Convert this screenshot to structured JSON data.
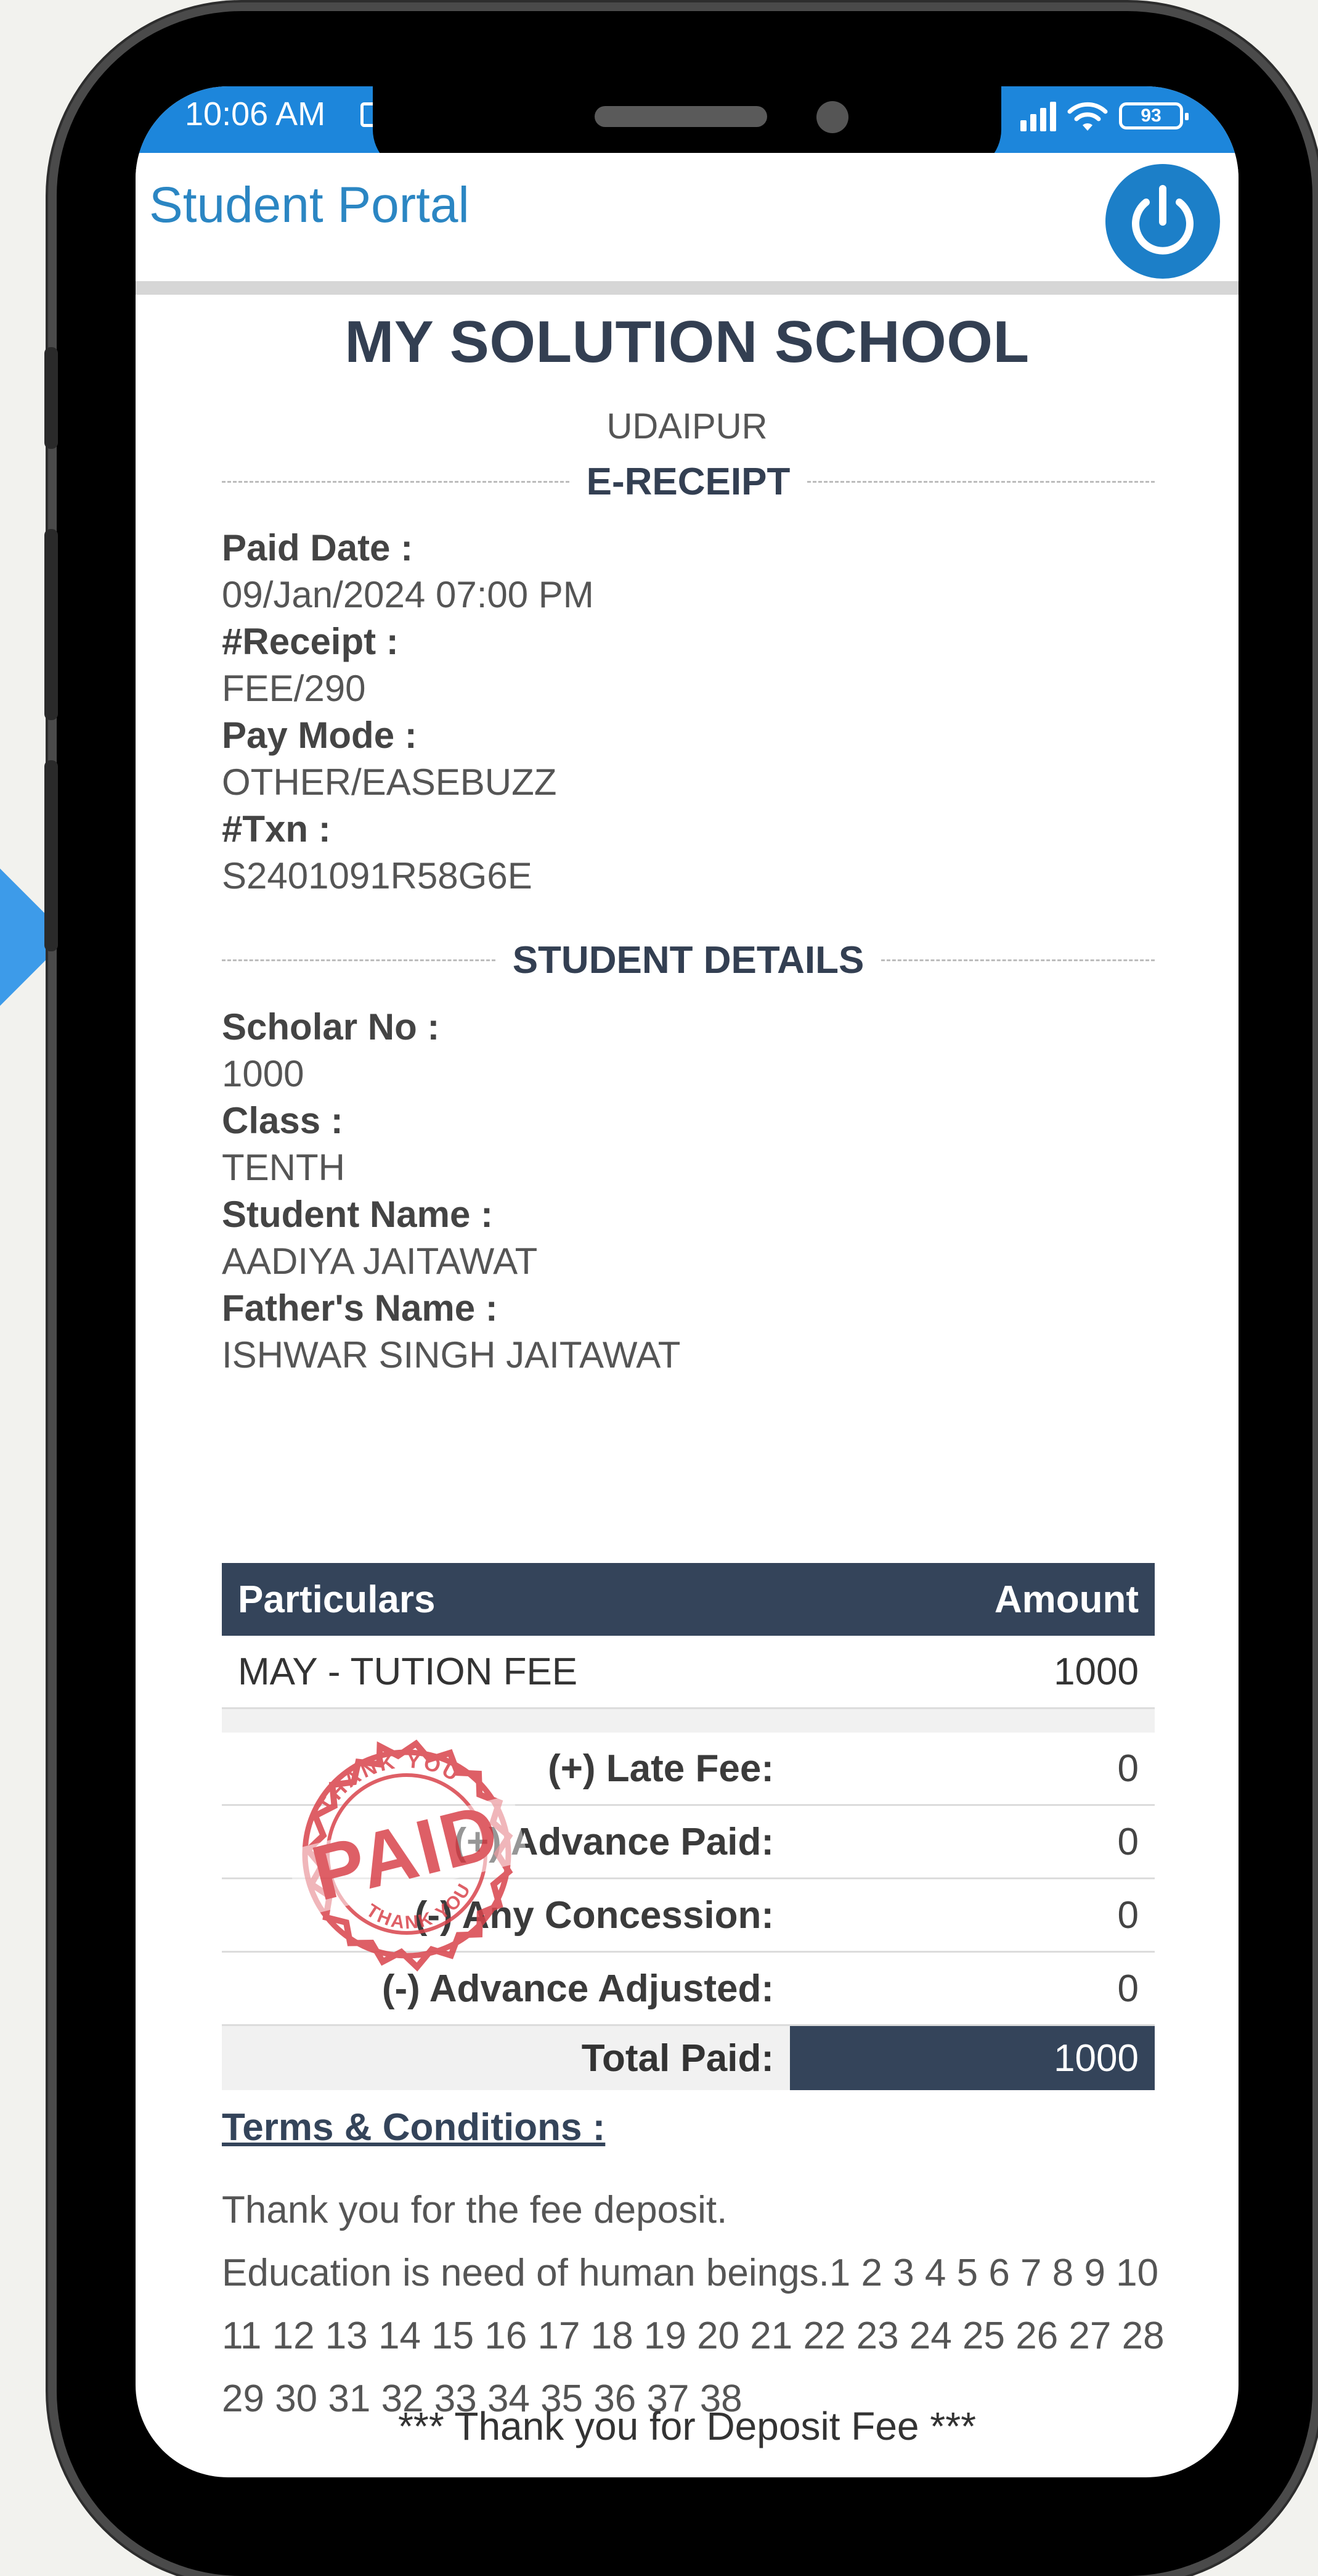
{
  "status_bar": {
    "time": "10:06 AM",
    "battery": "93"
  },
  "header": {
    "title": "Student Portal",
    "logout_icon": "power-icon"
  },
  "receipt": {
    "school_name": "MY SOLUTION SCHOOL",
    "city": "UDAIPUR",
    "section_receipt": "E-RECEIPT",
    "paid_date_label": "Paid Date :",
    "paid_date": "09/Jan/2024 07:00 PM",
    "receipt_label": "#Receipt :",
    "receipt_no": "FEE/290",
    "pay_mode_label": "Pay Mode :",
    "pay_mode": "OTHER/EASEBUZZ",
    "txn_label": "#Txn :",
    "txn": "S2401091R58G6E",
    "section_student": "STUDENT DETAILS",
    "scholar_label": "Scholar No :",
    "scholar_no": "1000",
    "class_label": "Class :",
    "class": "TENTH",
    "student_label": "Student Name :",
    "student_name": "AADIYA JAITAWAT",
    "father_label": "Father's Name :",
    "father_name": "ISHWAR SINGH JAITAWAT"
  },
  "fees": {
    "col_particulars": "Particulars",
    "col_amount": "Amount",
    "items": [
      {
        "name": "MAY - TUTION FEE",
        "amount": "1000"
      }
    ],
    "summary": [
      {
        "label": "(+) Late Fee:",
        "amount": "0"
      },
      {
        "label": "(+) Advance Paid:",
        "amount": "0"
      },
      {
        "label": "(-) Any Concession:",
        "amount": "0"
      },
      {
        "label": "(-) Advance Adjusted:",
        "amount": "0"
      }
    ],
    "total_label": "Total Paid:",
    "total_amount": "1000"
  },
  "stamp": {
    "main": "PAID",
    "ring_text": "THANK YOU",
    "color": "#d9444c"
  },
  "terms": {
    "title": "Terms & Conditions :",
    "line1": "Thank you for the fee deposit.",
    "line2": "Education is need of human beings.1 2 3 4 5 6 7 8 9 10 11 12 13 14 15 16 17 18 19 20 21 22 23 24 25 26 27 28 29 30 31 32 33 34 35 36 37 38"
  },
  "footer": {
    "thanks": "*** Thank you for Deposit Fee ***"
  },
  "colors": {
    "status_bar": "#1d86db",
    "title_blue": "#2b86c3",
    "table_header": "#34445a"
  }
}
